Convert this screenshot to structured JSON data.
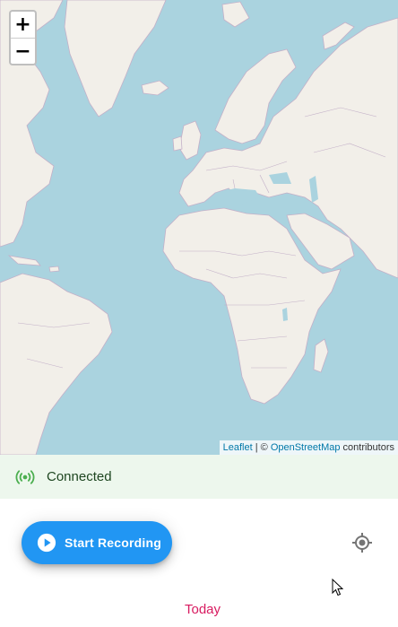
{
  "map": {
    "zoom_in_label": "+",
    "zoom_out_label": "−",
    "attribution": {
      "leaflet": "Leaflet",
      "separator": " | © ",
      "osm": "OpenStreetMap",
      "contributors": " contributors"
    },
    "colors": {
      "water": "#aad3df",
      "land": "#f2efe9",
      "borders": "#b9a8c0"
    }
  },
  "status": {
    "icon": "broadcast-signal-icon",
    "text": "Connected",
    "color": "#4caf50"
  },
  "recording": {
    "button_label": "Start Recording",
    "icon": "play-circle-icon",
    "accent": "#2196f3"
  },
  "locate": {
    "icon": "my-location-icon"
  },
  "day_header": {
    "label": "Today",
    "color": "#d81b60"
  }
}
